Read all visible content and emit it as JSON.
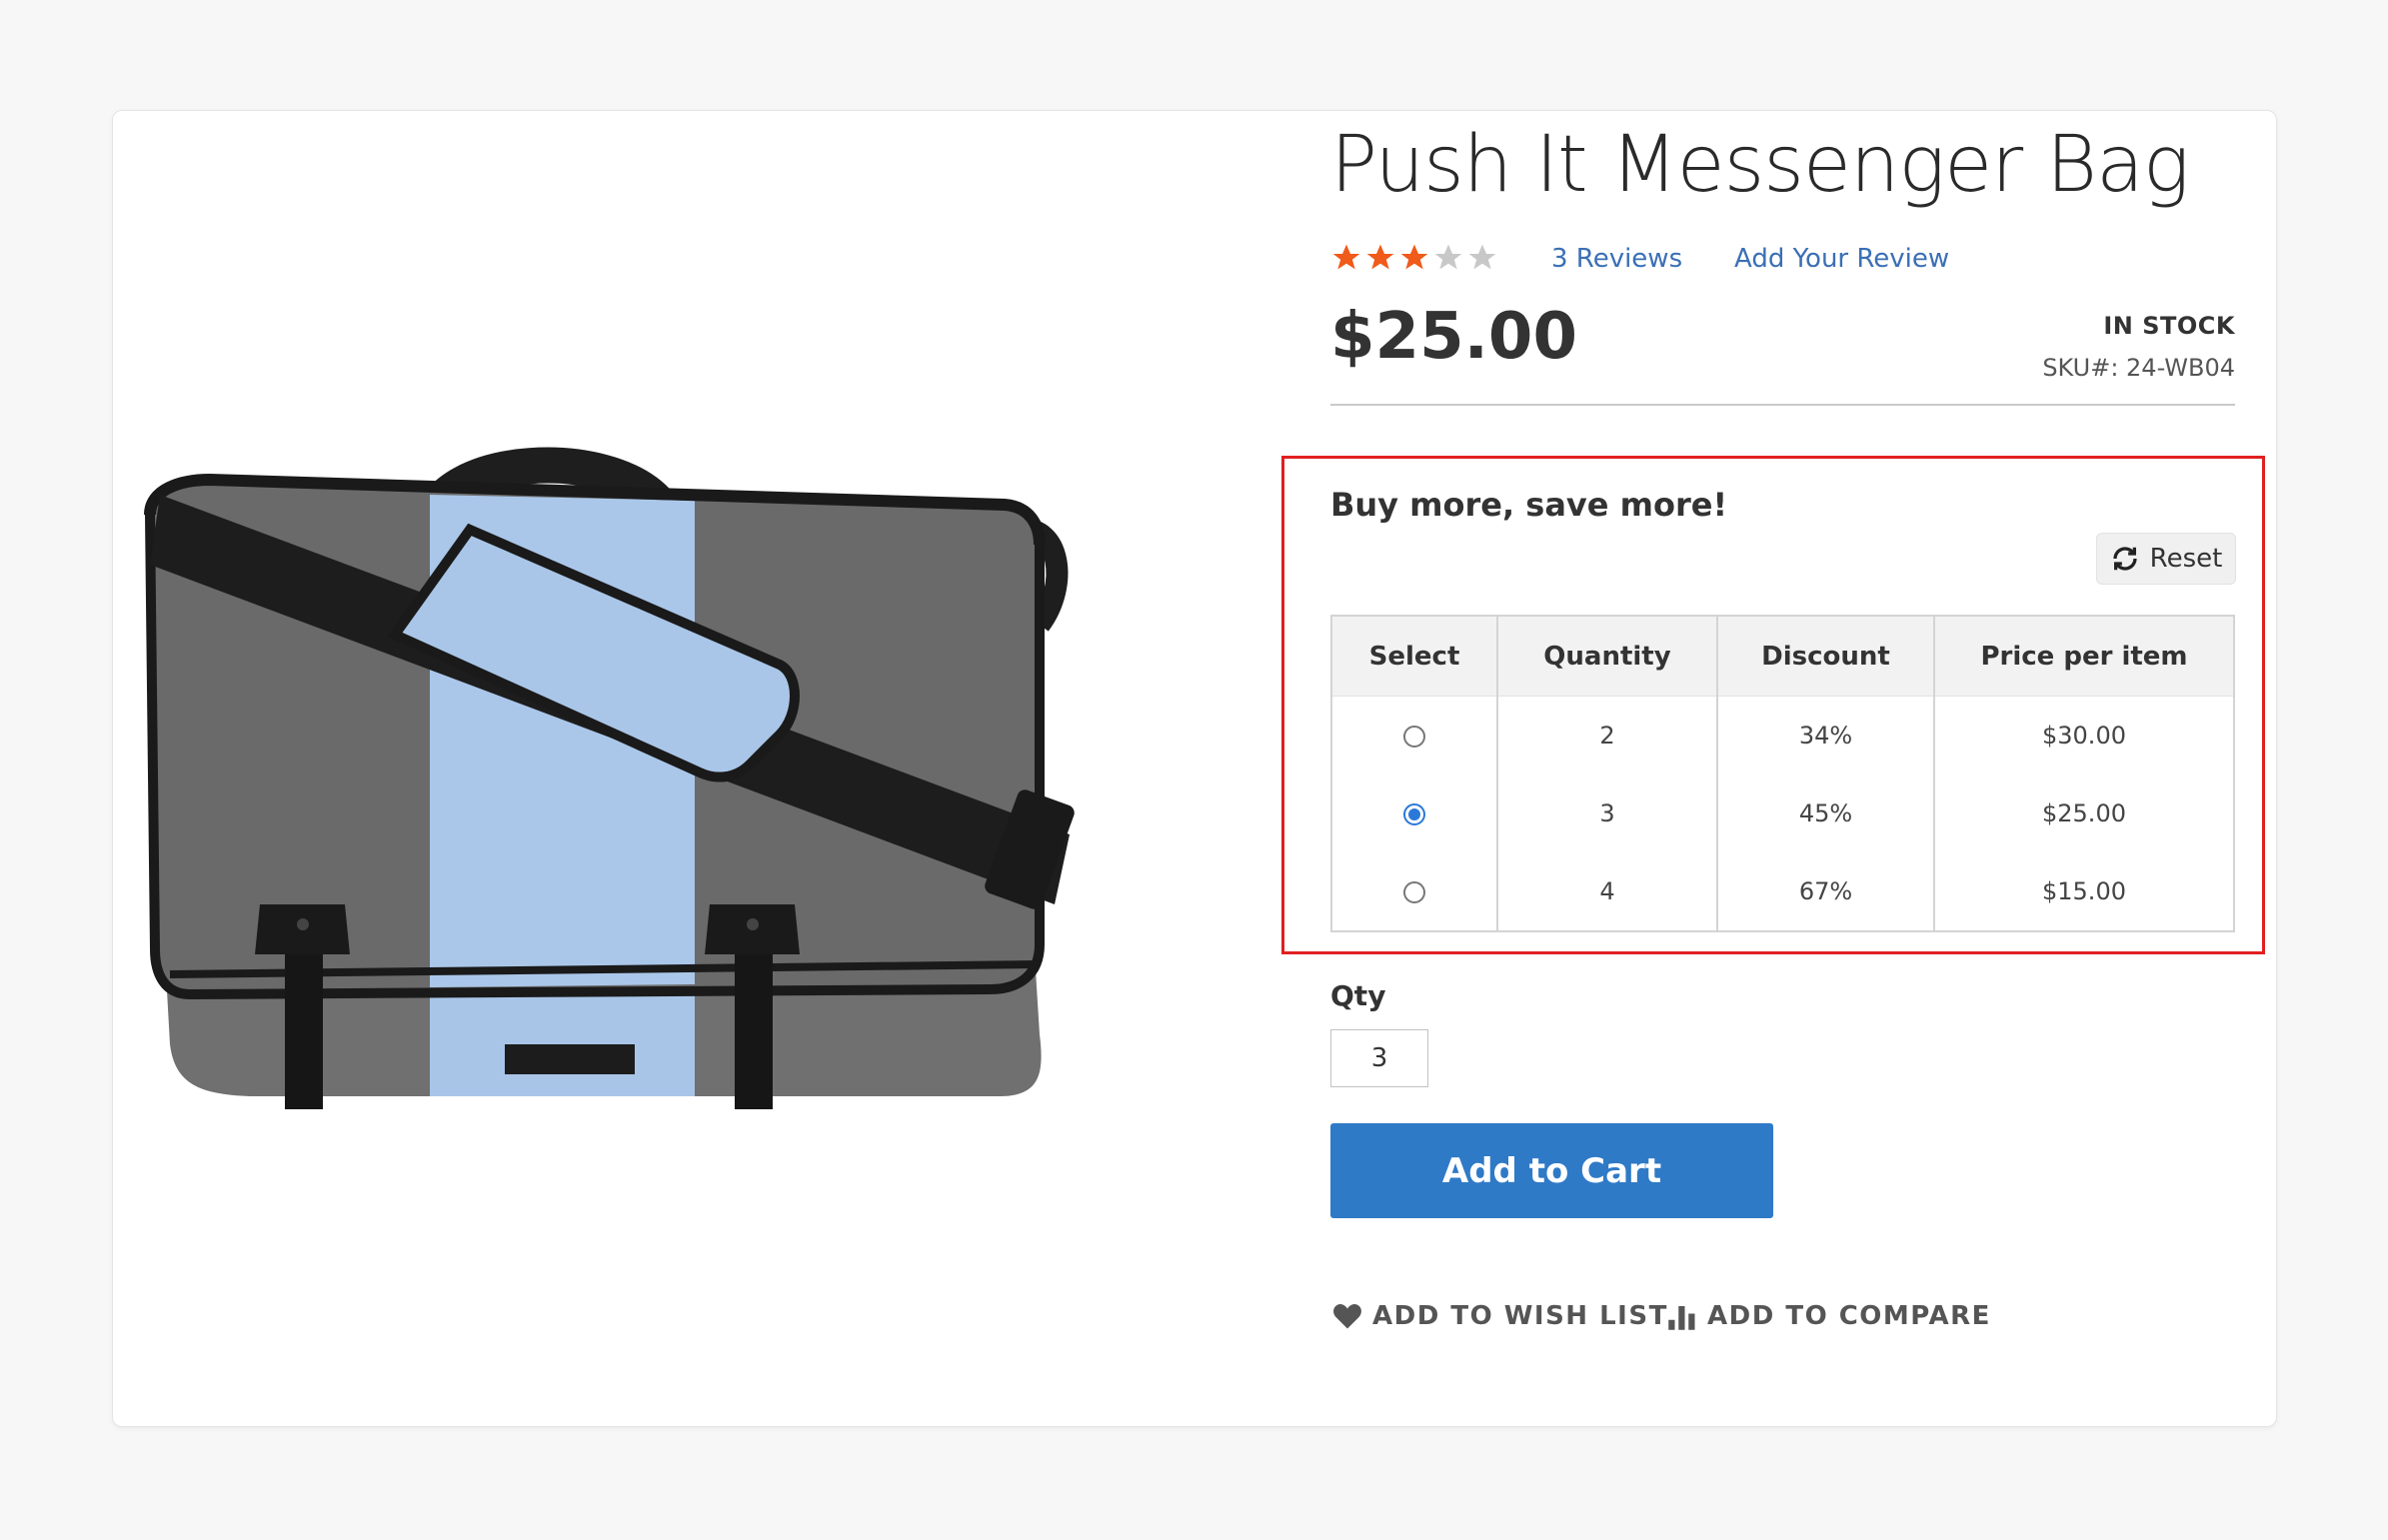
{
  "product": {
    "title": "Push It Messenger Bag",
    "rating_fraction": 0.6,
    "reviews_link": "3  Reviews",
    "add_review_link": "Add Your Review",
    "price": "$25.00",
    "stock_status": "IN STOCK",
    "sku": "SKU#:  24-WB04",
    "image_icon": "messenger-bag-image"
  },
  "tier_pricing": {
    "heading": "Buy more, save more!",
    "reset_label": "Reset",
    "columns": [
      "Select",
      "Quantity",
      "Discount",
      "Price per item"
    ],
    "rows": [
      {
        "selected": false,
        "quantity": "2",
        "discount": "34%",
        "price": "$30.00"
      },
      {
        "selected": true,
        "quantity": "3",
        "discount": "45%",
        "price": "$25.00"
      },
      {
        "selected": false,
        "quantity": "4",
        "discount": "67%",
        "price": "$15.00"
      }
    ],
    "highlight_color": "#e02020"
  },
  "purchase": {
    "qty_label": "Qty",
    "qty_value": "3",
    "add_to_cart_label": "Add to Cart",
    "button_color": "#2f7ac7"
  },
  "actions": {
    "wishlist_label": "ADD TO WISH LIST",
    "compare_label": "ADD TO COMPARE"
  }
}
